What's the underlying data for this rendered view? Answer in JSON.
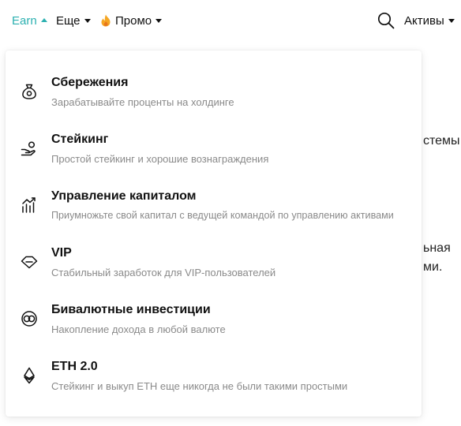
{
  "nav": {
    "earn": "Earn",
    "more": "Еще",
    "promo": "Промо",
    "assets": "Активы",
    "earn_color": "#2bb0b0"
  },
  "background_text": {
    "line1": "стемы",
    "line2": "ьная",
    "line3": "ми."
  },
  "menu": [
    {
      "icon": "money-bag-icon",
      "title": "Сбережения",
      "desc": "Зарабатывайте проценты на холдинге"
    },
    {
      "icon": "hand-coin-icon",
      "title": "Стейкинг",
      "desc": "Простой стейкинг и хорошие вознаграждения"
    },
    {
      "icon": "growth-chart-icon",
      "title": "Управление капиталом",
      "desc": "Приумножьте свой капитал с ведущей командой по управлению активами"
    },
    {
      "icon": "diamond-icon",
      "title": "VIP",
      "desc": "Стабильный заработок для VIP-пользователей"
    },
    {
      "icon": "dual-currency-icon",
      "title": "Бивалютные инвестиции",
      "desc": "Накопление дохода в любой валюте"
    },
    {
      "icon": "ethereum-icon",
      "title": "ETH 2.0",
      "desc": "Стейкинг и выкуп ETH еще никогда не были такими простыми"
    }
  ]
}
